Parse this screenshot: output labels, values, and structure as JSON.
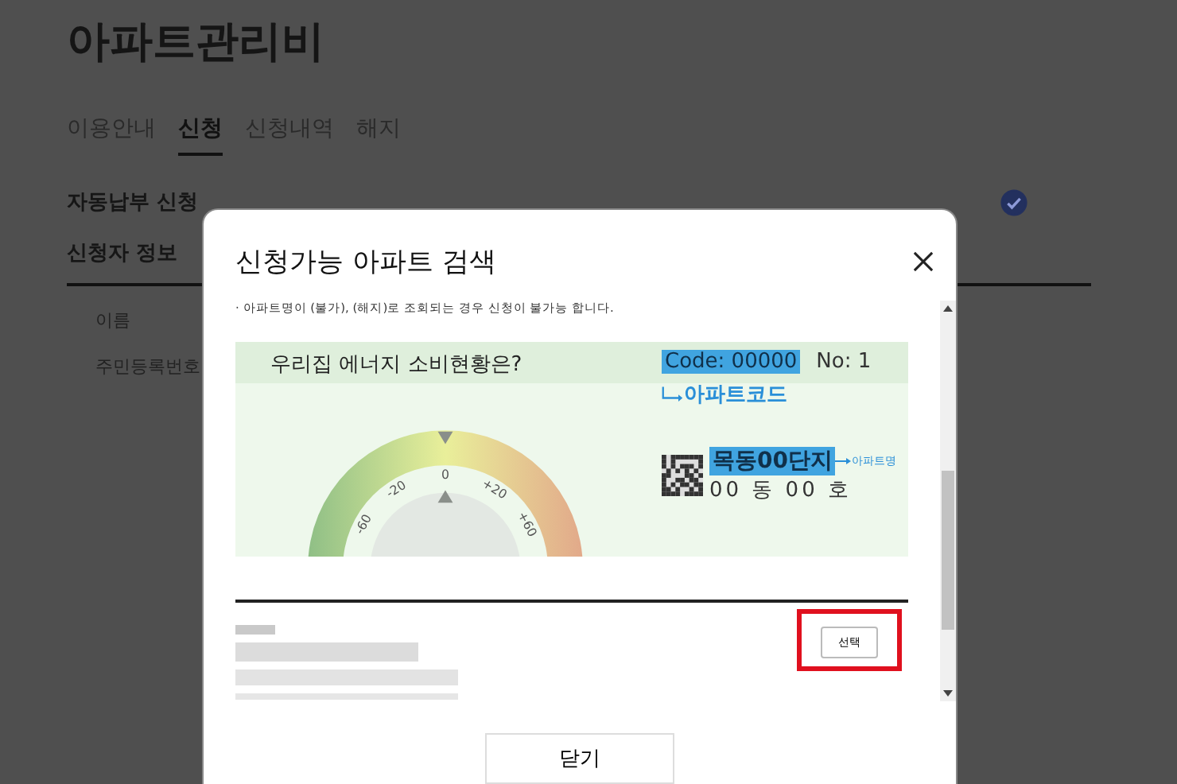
{
  "page": {
    "title": "아파트관리비",
    "tabs": [
      {
        "label": "이용안내",
        "selected": false
      },
      {
        "label": "신청",
        "selected": true
      },
      {
        "label": "신청내역",
        "selected": false
      },
      {
        "label": "해지",
        "selected": false
      }
    ],
    "section_title": "자동납부 신청",
    "consent_checked": true,
    "applicant": {
      "title": "신청자 정보",
      "fields": [
        "이름",
        "주민등록번호"
      ]
    }
  },
  "modal": {
    "title": "신청가능 아파트 검색",
    "notice": "· 아파트명이 (불가), (해지)로 조회되는 경우 신청이 불가능 합니다.",
    "banner": {
      "heading": "우리집 에너지 소비현황은?",
      "code": "Code: 00000",
      "number": "No: 1",
      "code_label": "아파트코드",
      "apartment_name": "목동00단지",
      "apartment_name_label": "아파트명",
      "unit": "00 동 00 호",
      "gauge_ticks": [
        "-60",
        "-20",
        "0",
        "+20",
        "+60"
      ]
    },
    "result": {
      "select_button": "선택",
      "highlighted": true
    },
    "close_button": "닫기"
  }
}
